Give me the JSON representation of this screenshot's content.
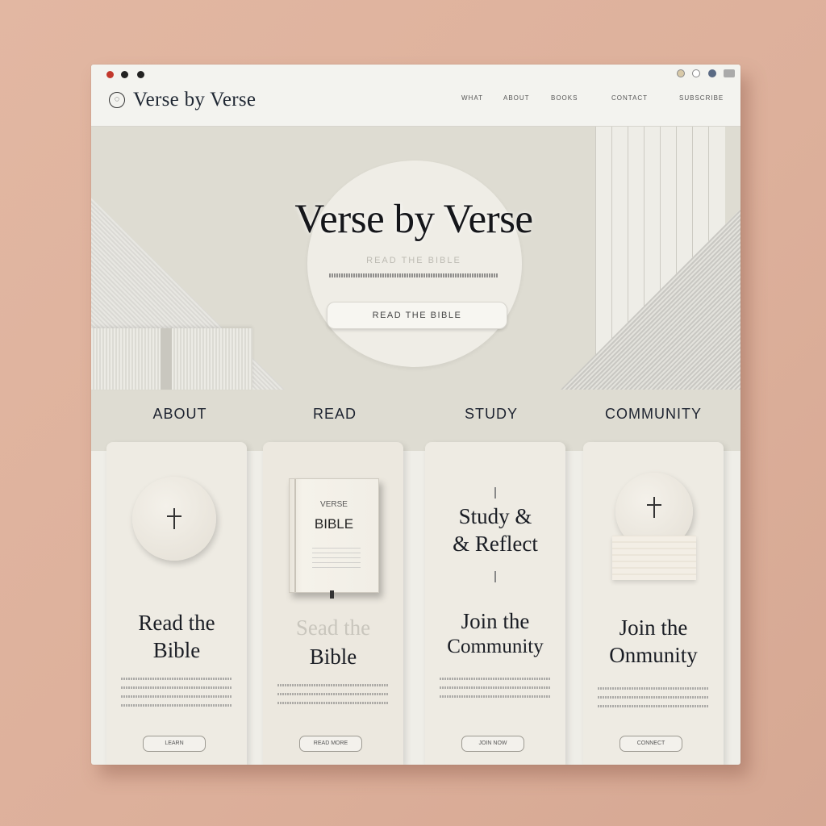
{
  "app": {
    "brand": "Verse by Verse",
    "logo_icon": "open-circle-icon"
  },
  "window_controls": [
    "close",
    "minimize",
    "maximize"
  ],
  "nav": {
    "items": [
      "WHAT",
      "ABOUT",
      "BOOKS",
      "CONTACT",
      "SUBSCRIBE"
    ]
  },
  "hero": {
    "title": "Verse by Verse",
    "subtitle": "READ THE BIBLE",
    "cta": "READ THE BIBLE"
  },
  "sections": [
    "ABOUT",
    "READ",
    "STUDY",
    "COMMUNITY"
  ],
  "cards": [
    {
      "title_line1": "Read the",
      "title_line2": "Bible",
      "icon": "cross-icon",
      "button": "LEARN"
    },
    {
      "book_small": "VERSE",
      "book_label": "BIBLE",
      "ghost_line": "Sead the",
      "title_line2": "Bible",
      "icon": "bible-book-icon",
      "button": "READ MORE"
    },
    {
      "heading_line1": "Study &",
      "heading_line2": "& Reflect",
      "title_line1": "Join the",
      "title_line2": "Community",
      "button": "JOIN NOW"
    },
    {
      "title_line1": "Join the",
      "title_line2": "Onmunity",
      "icon": "cross-icon",
      "button": "CONNECT"
    }
  ],
  "colors": {
    "accent": "#1d2330",
    "background": "#e2b7a2",
    "panel": "#efeee8"
  }
}
